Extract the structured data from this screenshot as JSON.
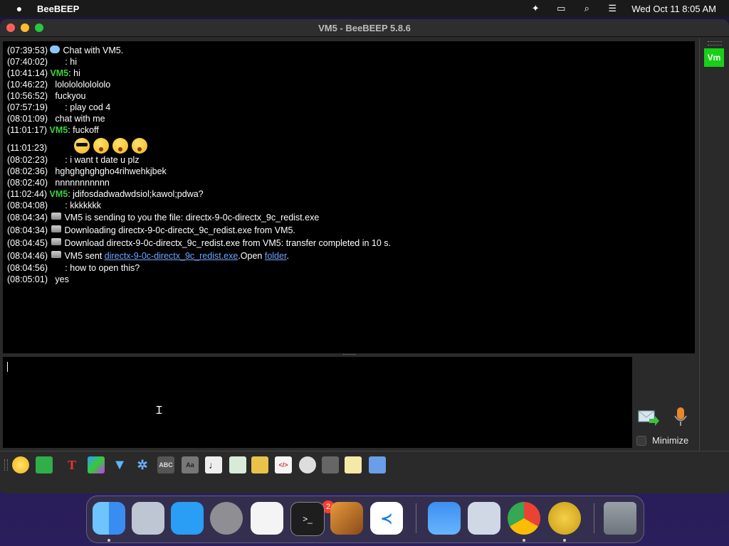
{
  "menubar": {
    "app_name": "BeeBEEP",
    "datetime": "Wed Oct 11  8:05 AM",
    "icons": [
      "apple-icon",
      "beebeep-tray-icon",
      "screen-mirroring-icon",
      "spotlight-search-icon",
      "control-center-icon"
    ]
  },
  "window": {
    "title": "VM5 - BeeBEEP 5.8.6"
  },
  "chat": {
    "lines": [
      {
        "time": "(07:39:53)",
        "sender": "",
        "text": "Chat with VM5."
      },
      {
        "time": "(07:40:02)",
        "sender": "",
        "text": "      : hi"
      },
      {
        "time": "(10:41:14)",
        "sender": "VM5",
        "text": ": hi"
      },
      {
        "time": "(10:46:22)",
        "sender": "",
        "text": "  lolololololololo"
      },
      {
        "time": "(10:56:52)",
        "sender": "",
        "text": "  fuckyou"
      },
      {
        "time": "(07:57:19)",
        "sender": "",
        "text": "      : play cod 4"
      },
      {
        "time": "(08:01:09)",
        "sender": "",
        "text": "  chat with me"
      },
      {
        "time": "(11:01:17)",
        "sender": "VM5",
        "text": ": fuckoff"
      },
      {
        "time": "(11:01:23)",
        "sender": "",
        "text": ""
      },
      {
        "time": "(08:02:23)",
        "sender": "",
        "text": "      : i want t date u plz"
      },
      {
        "time": "(08:02:36)",
        "sender": "",
        "text": "  hghghghghgho4rihwehkjbek"
      },
      {
        "time": "(08:02:40)",
        "sender": "",
        "text": "  nnnnnnnnnnn"
      },
      {
        "time": "(11:02:44)",
        "sender": "VM5",
        "text": ": jdifosdadwadwdsiol;kawol;pdwa?"
      },
      {
        "time": "(08:04:08)",
        "sender": "",
        "text": "      : kkkkkkk"
      },
      {
        "time": "(08:04:34)",
        "sender": "",
        "text": "VM5 is sending to you the file: directx-9-0c-directx_9c_redist.exe"
      },
      {
        "time": "(08:04:34)",
        "sender": "",
        "text": "Downloading directx-9-0c-directx_9c_redist.exe from VM5."
      },
      {
        "time": "(08:04:45)",
        "sender": "",
        "text": "Download directx-9-0c-directx_9c_redist.exe from VM5: transfer completed in 10 s."
      },
      {
        "time": "(08:04:46)",
        "sender": "",
        "text": "VM5 sent "
      },
      {
        "time": "(08:04:56)",
        "sender": "",
        "text": "      : how to open this?"
      },
      {
        "time": "(08:05:01)",
        "sender": "",
        "text": "  yes"
      }
    ],
    "sent_file_link": "directx-9-0c-directx_9c_redist.exe",
    "open_text": ".Open ",
    "folder_link": "folder",
    "period": "."
  },
  "user_badge": "Vm",
  "minimize_label": "Minimize",
  "toolbar_icons": [
    "emoji-icon",
    "send-file-icon",
    "font-icon",
    "color-icon",
    "filter-icon",
    "settings-icon",
    "spellcheck-icon",
    "dictionary-icon",
    "music-note-icon",
    "save-chat-icon",
    "download-folder-icon",
    "html-icon",
    "record-icon",
    "screenshot-icon",
    "notes-icon",
    "share-icon"
  ],
  "dock": {
    "notification_count": "2",
    "apps": [
      "finder-icon",
      "launchpad-icon",
      "app-store-icon",
      "system-settings-icon",
      "textedit-icon",
      "terminal-icon",
      "garageband-icon",
      "vscode-icon",
      "weather-icon",
      "preview-icon",
      "chrome-icon",
      "beebeep-icon",
      "trash-icon"
    ]
  }
}
